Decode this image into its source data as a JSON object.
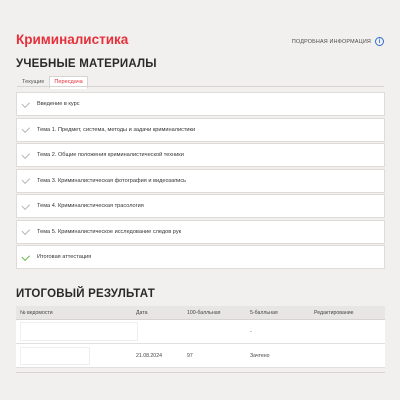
{
  "header": {
    "course_title": "Криминалистика",
    "more_info_label": "ПОДРОБНАЯ ИНФОРМАЦИЯ",
    "info_icon_glyph": "i"
  },
  "materials": {
    "title": "УЧЕБНЫЕ МАТЕРИАЛЫ",
    "tabs": [
      {
        "label": "Текущие",
        "active": false
      },
      {
        "label": "Пересдача",
        "active": true
      }
    ],
    "modules": [
      {
        "label": "Введение в курс",
        "completed": false
      },
      {
        "label": "Тема 1. Предмет, система, методы и задачи криминалистики",
        "completed": false
      },
      {
        "label": "Тема 2. Общие положения криминалистической техники",
        "completed": false
      },
      {
        "label": "Тема 3. Криминалистическая фотография и видеозапись",
        "completed": false
      },
      {
        "label": "Тема 4. Криминалистическая трасология",
        "completed": false
      },
      {
        "label": "Тема 5. Криминалистическое исследование следов рук",
        "completed": false
      },
      {
        "label": "Итоговая аттестация",
        "completed": true
      }
    ]
  },
  "results": {
    "title": "ИТОГОВЫЙ РЕЗУЛЬТАТ",
    "columns": [
      "№ ведомости",
      "Дата",
      "100-балльная",
      "5-балльная",
      "Редактирование"
    ],
    "rows": [
      {
        "statement_no": "",
        "date": "",
        "score100": "",
        "score5": "-",
        "edit": ""
      },
      {
        "statement_no": "",
        "date": "21.08.2024",
        "score100": "97",
        "score5": "Зачтено",
        "edit": ""
      }
    ]
  },
  "colors": {
    "accent_red": "#e5303c",
    "info_blue": "#2f6fd1",
    "check_green": "#66b84a",
    "background": "#f2f0ee"
  }
}
